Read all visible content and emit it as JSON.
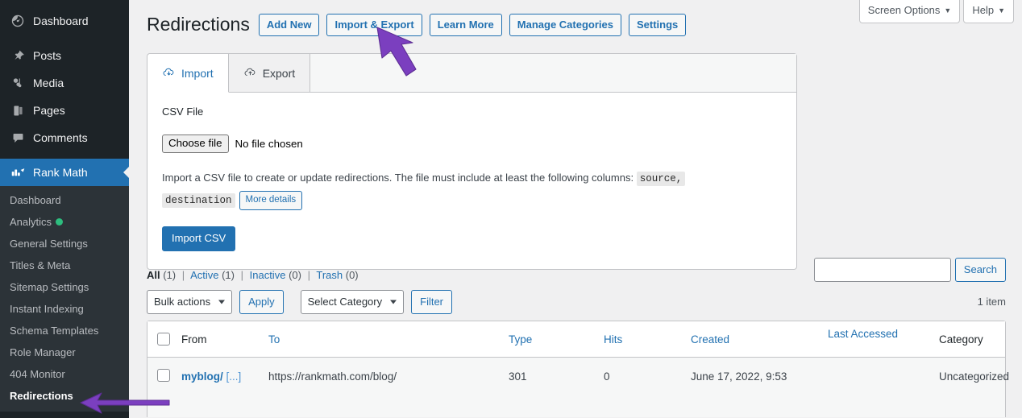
{
  "sidebar": {
    "top_items": [
      {
        "label": "Dashboard",
        "icon": "dashboard-icon"
      },
      {
        "label": "Posts",
        "icon": "pin-icon"
      },
      {
        "label": "Media",
        "icon": "media-icon"
      },
      {
        "label": "Pages",
        "icon": "pages-icon"
      },
      {
        "label": "Comments",
        "icon": "comments-icon"
      }
    ],
    "active_item": {
      "label": "Rank Math",
      "icon": "rank-math-icon"
    },
    "submenu": [
      {
        "label": "Dashboard",
        "current": false,
        "dot": false
      },
      {
        "label": "Analytics",
        "current": false,
        "dot": true
      },
      {
        "label": "General Settings",
        "current": false,
        "dot": false
      },
      {
        "label": "Titles & Meta",
        "current": false,
        "dot": false
      },
      {
        "label": "Sitemap Settings",
        "current": false,
        "dot": false
      },
      {
        "label": "Instant Indexing",
        "current": false,
        "dot": false
      },
      {
        "label": "Schema Templates",
        "current": false,
        "dot": false
      },
      {
        "label": "Role Manager",
        "current": false,
        "dot": false
      },
      {
        "label": "404 Monitor",
        "current": false,
        "dot": false
      },
      {
        "label": "Redirections",
        "current": true,
        "dot": false
      }
    ]
  },
  "screen_meta": {
    "screen_options": "Screen Options",
    "help": "Help",
    "caret": "▼"
  },
  "header": {
    "title": "Redirections",
    "buttons": [
      {
        "label": "Add New",
        "name": "add-new-button"
      },
      {
        "label": "Import & Export",
        "name": "import-export-button"
      },
      {
        "label": "Learn More",
        "name": "learn-more-button"
      },
      {
        "label": "Manage Categories",
        "name": "manage-categories-button"
      },
      {
        "label": "Settings",
        "name": "settings-button"
      }
    ]
  },
  "panel": {
    "tabs": [
      {
        "label": "Import",
        "icon": "cloud-download-icon",
        "active": true
      },
      {
        "label": "Export",
        "icon": "cloud-upload-icon",
        "active": false
      }
    ],
    "csv_label": "CSV File",
    "choose_file_label": "Choose file",
    "no_file_text": "No file chosen",
    "help_text_before": "Import a CSV file to create or update redirections. The file must include at least the following columns:",
    "code_source": "source,",
    "code_destination": "destination",
    "more_details_label": "More details",
    "import_button": "Import CSV"
  },
  "status_links": {
    "all": {
      "label": "All",
      "count": "(1)"
    },
    "active": {
      "label": "Active",
      "count": "(1)"
    },
    "inactive": {
      "label": "Inactive",
      "count": "(0)"
    },
    "trash": {
      "label": "Trash",
      "count": "(0)"
    },
    "separator": "|"
  },
  "search": {
    "value": "",
    "placeholder": "",
    "button_label": "Search"
  },
  "tablenav": {
    "bulk_actions": "Bulk actions",
    "apply_label": "Apply",
    "select_category": "Select Category",
    "filter_label": "Filter",
    "item_count": "1 item"
  },
  "table": {
    "columns": [
      {
        "label": "From",
        "sortable": false
      },
      {
        "label": "To",
        "sortable": true
      },
      {
        "label": "Type",
        "sortable": true
      },
      {
        "label": "Hits",
        "sortable": true
      },
      {
        "label": "Created",
        "sortable": true
      },
      {
        "label": "Last Accessed",
        "sortable": true
      },
      {
        "label": "Category",
        "sortable": false
      }
    ],
    "rows": [
      {
        "from_main": "myblog/",
        "from_more": "[...]",
        "to": "https://rankmath.com/blog/",
        "type": "301",
        "hits": "0",
        "created": "June 17, 2022, 9:53",
        "last_accessed": "",
        "category": "Uncategorized"
      }
    ]
  },
  "annotations": {
    "arrow_color": "#7b3fbf",
    "arrow_top_target": "import-export-button",
    "arrow_side_target": "sidebar-item-redirections"
  }
}
